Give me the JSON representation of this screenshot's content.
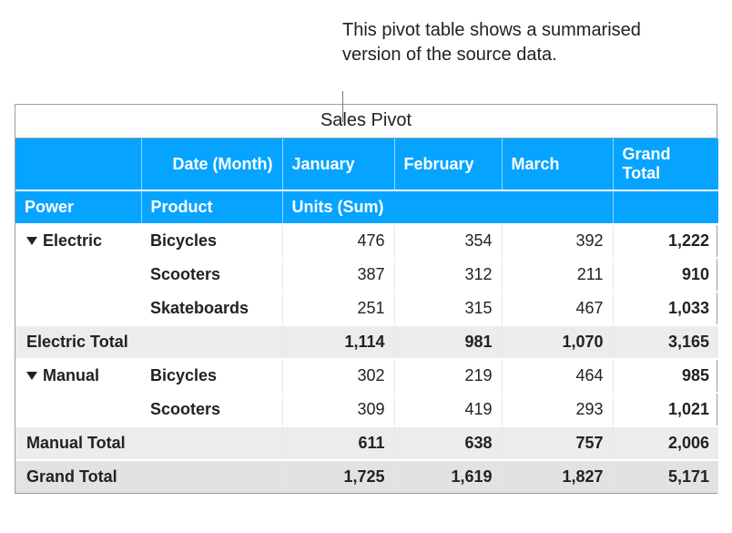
{
  "callout": "This pivot table shows a summarised version of the source data.",
  "title": "Sales Pivot",
  "hdr1": {
    "date_month": "Date (Month)",
    "jan": "January",
    "feb": "February",
    "mar": "March",
    "grand_total": "Grand Total"
  },
  "hdr2": {
    "power": "Power",
    "product": "Product",
    "units_sum": "Units (Sum)"
  },
  "electric": {
    "label": "Electric",
    "rows": {
      "bicycles": {
        "product": "Bicycles",
        "jan": "476",
        "feb": "354",
        "mar": "392",
        "total": "1,222"
      },
      "scooters": {
        "product": "Scooters",
        "jan": "387",
        "feb": "312",
        "mar": "211",
        "total": "910"
      },
      "skateboards": {
        "product": "Skateboards",
        "jan": "251",
        "feb": "315",
        "mar": "467",
        "total": "1,033"
      }
    },
    "subtotal": {
      "label": "Electric Total",
      "jan": "1,114",
      "feb": "981",
      "mar": "1,070",
      "total": "3,165"
    }
  },
  "manual": {
    "label": "Manual",
    "rows": {
      "bicycles": {
        "product": "Bicycles",
        "jan": "302",
        "feb": "219",
        "mar": "464",
        "total": "985"
      },
      "scooters": {
        "product": "Scooters",
        "jan": "309",
        "feb": "419",
        "mar": "293",
        "total": "1,021"
      }
    },
    "subtotal": {
      "label": "Manual Total",
      "jan": "611",
      "feb": "638",
      "mar": "757",
      "total": "2,006"
    }
  },
  "grand": {
    "label": "Grand Total",
    "jan": "1,725",
    "feb": "1,619",
    "mar": "1,827",
    "total": "5,171"
  },
  "chart_data": {
    "type": "table",
    "title": "Sales Pivot",
    "row_fields": [
      "Power",
      "Product"
    ],
    "column_field": "Date (Month)",
    "value_field": "Units (Sum)",
    "columns": [
      "January",
      "February",
      "March",
      "Grand Total"
    ],
    "rows": [
      {
        "power": "Electric",
        "product": "Bicycles",
        "January": 476,
        "February": 354,
        "March": 392,
        "Grand Total": 1222
      },
      {
        "power": "Electric",
        "product": "Scooters",
        "January": 387,
        "February": 312,
        "March": 211,
        "Grand Total": 910
      },
      {
        "power": "Electric",
        "product": "Skateboards",
        "January": 251,
        "February": 315,
        "March": 467,
        "Grand Total": 1033
      },
      {
        "power": "Electric",
        "product": "(subtotal)",
        "January": 1114,
        "February": 981,
        "March": 1070,
        "Grand Total": 3165
      },
      {
        "power": "Manual",
        "product": "Bicycles",
        "January": 302,
        "February": 219,
        "March": 464,
        "Grand Total": 985
      },
      {
        "power": "Manual",
        "product": "Scooters",
        "January": 309,
        "February": 419,
        "March": 293,
        "Grand Total": 1021
      },
      {
        "power": "Manual",
        "product": "(subtotal)",
        "January": 611,
        "February": 638,
        "March": 757,
        "Grand Total": 2006
      },
      {
        "power": "(grand)",
        "product": "(grand)",
        "January": 1725,
        "February": 1619,
        "March": 1827,
        "Grand Total": 5171
      }
    ]
  }
}
